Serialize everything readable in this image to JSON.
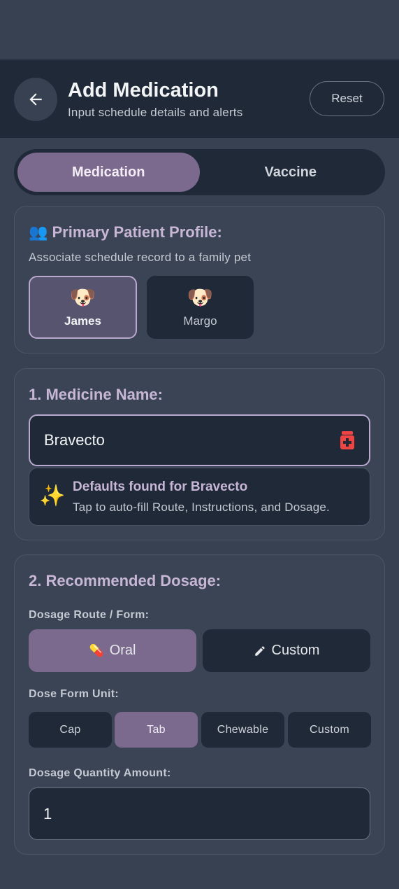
{
  "header": {
    "title": "Add Medication",
    "subtitle": "Input schedule details and alerts",
    "reset_label": "Reset",
    "back_icon": "arrow-left-icon"
  },
  "tabs": [
    {
      "label": "Medication",
      "active": true
    },
    {
      "label": "Vaccine",
      "active": false
    }
  ],
  "profile": {
    "title": "👥 Primary Patient Profile:",
    "subtitle": "Associate schedule record to a family pet",
    "pets": [
      {
        "emoji": "🐶",
        "name": "James",
        "selected": true
      },
      {
        "emoji": "🐶",
        "name": "Margo",
        "selected": false
      }
    ]
  },
  "medicine": {
    "title": "1. Medicine Name:",
    "value": "Bravecto",
    "icon": "pill-bottle-icon",
    "defaults_icon": "✨",
    "defaults_title": "Defaults found for Bravecto",
    "defaults_sub": "Tap to auto-fill Route, Instructions, and Dosage."
  },
  "dosage": {
    "title": "2. Recommended Dosage:",
    "route_label": "Dosage Route / Form:",
    "routes": [
      {
        "label": "Oral",
        "icon": "💊",
        "active": true
      },
      {
        "label": "Custom",
        "icon": "pencil-icon",
        "active": false
      }
    ],
    "unit_label": "Dose Form Unit:",
    "units": [
      {
        "label": "Cap",
        "active": false
      },
      {
        "label": "Tab",
        "active": true
      },
      {
        "label": "Chewable",
        "active": false
      },
      {
        "label": "Custom",
        "active": false
      }
    ],
    "qty_label": "Dosage Quantity Amount:",
    "qty_value": "1"
  },
  "colors": {
    "accent": "#7c6a8e",
    "header_bg": "#1f2937",
    "card_bg": "#3a4455",
    "pill_icon": "#ef4444"
  }
}
